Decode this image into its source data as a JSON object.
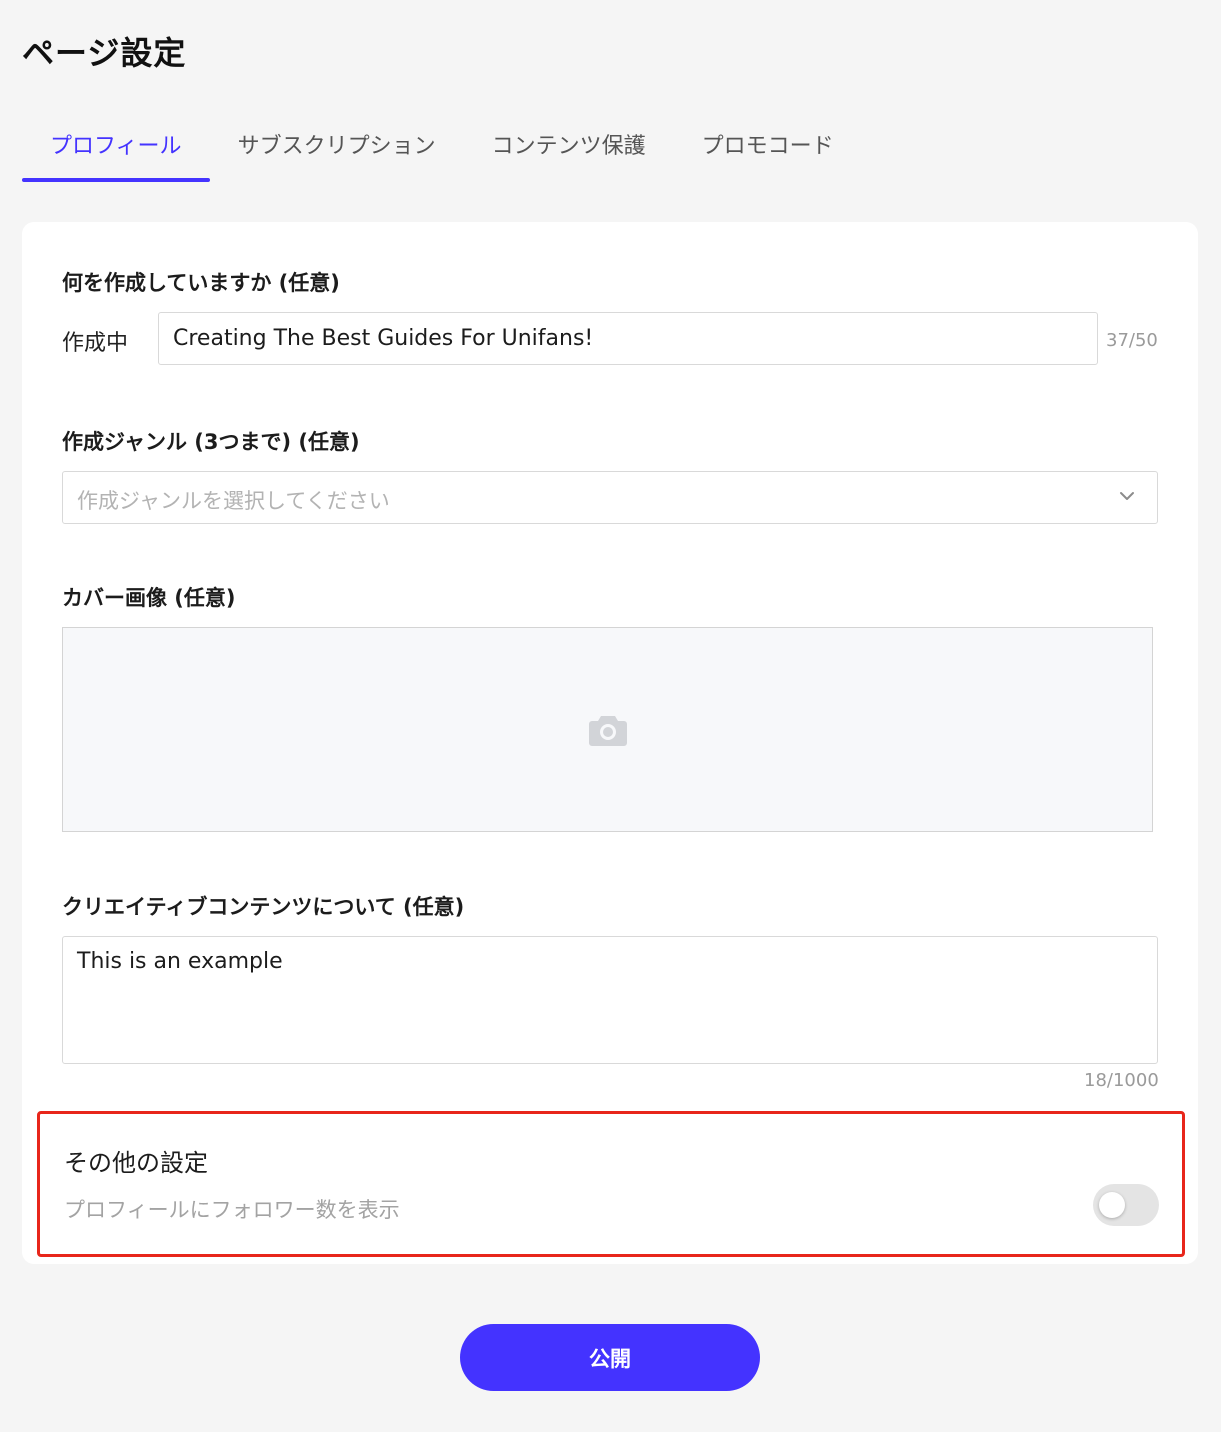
{
  "page": {
    "title": "ページ設定"
  },
  "tabs": [
    {
      "label": "プロフィール",
      "active": true
    },
    {
      "label": "サブスクリプション",
      "active": false
    },
    {
      "label": "コンテンツ保護",
      "active": false
    },
    {
      "label": "プロモコード",
      "active": false
    }
  ],
  "creating": {
    "label": "何を作成していますか (任意)",
    "prefix": "作成中",
    "value": "Creating The Best Guides For Unifans!",
    "counter": "37/50"
  },
  "genre": {
    "label": "作成ジャンル (3つまで) (任意)",
    "placeholder": "作成ジャンルを選択してください"
  },
  "cover": {
    "label": "カバー画像 (任意)",
    "icon": "camera-icon"
  },
  "about": {
    "label": "クリエイティブコンテンツについて (任意)",
    "value": "This is an example",
    "counter": "18/1000"
  },
  "other_settings": {
    "title": "その他の設定",
    "follower_toggle_label": "プロフィールにフォロワー数を表示",
    "follower_toggle_on": false
  },
  "publish": {
    "label": "公開"
  },
  "colors": {
    "accent": "#4433ff",
    "highlight_border": "#e8261b",
    "background": "#f5f5f5"
  }
}
